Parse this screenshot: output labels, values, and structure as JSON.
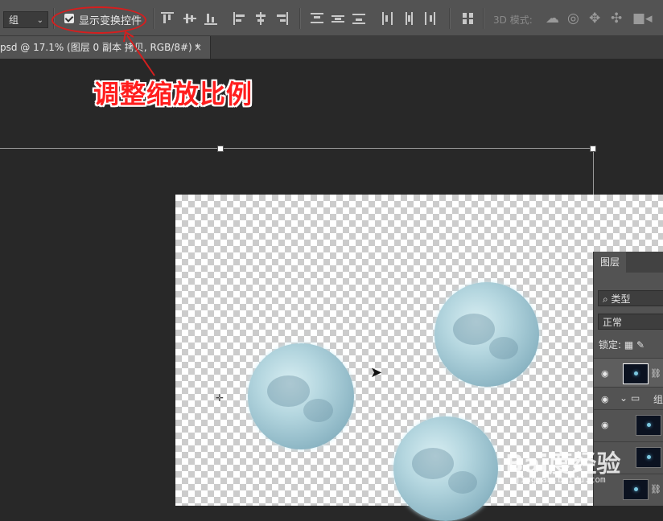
{
  "options_bar": {
    "auto_select_value": "组",
    "show_transform_label": "显示变换控件",
    "mode_label": "3D 模式:",
    "icons": [
      "align-top-icon",
      "align-vcenter-icon",
      "align-bottom-icon",
      "align-left-icon",
      "align-hcenter-icon",
      "align-right-icon",
      "distribute-top-icon",
      "distribute-vcenter-icon",
      "distribute-bottom-icon",
      "distribute-left-icon",
      "distribute-hcenter-icon",
      "distribute-right-icon",
      "auto-align-icon",
      "rotate-3d-icon",
      "roll-3d-icon",
      "drag-3d-icon",
      "slide-3d-icon",
      "scale-3d-icon"
    ]
  },
  "document_tab": {
    "title": "psd @ 17.1% (图层 0 副本 拷贝, RGB/8#) *",
    "close": "×"
  },
  "annotation": {
    "text": "调整缩放比例",
    "color": "#ff1e1e"
  },
  "layers_panel": {
    "tab_label": "图层",
    "filter_value": "类型",
    "blend_mode": "正常",
    "lock_label": "锁定:",
    "group_label": "组"
  },
  "watermark": {
    "text": "Bai度经验",
    "url": "jingyan.baidu.com"
  }
}
